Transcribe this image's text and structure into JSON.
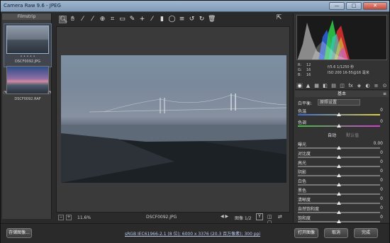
{
  "window": {
    "title": "Camera Raw 9.6 - JPEG",
    "buttons": [
      "—",
      "□",
      "✕"
    ]
  },
  "filmstrip": {
    "title": "Filmstrip",
    "items": [
      {
        "name": "DSCF0092.JPG",
        "stars": "• • • • •",
        "selected": true
      },
      {
        "name": "DSCF0092.RAF",
        "stars": "",
        "selected": false
      }
    ]
  },
  "toolbar": {
    "tools": [
      {
        "name": "zoom-tool-icon",
        "glyph": "🔍︎",
        "active": true
      },
      {
        "name": "hand-tool-icon",
        "glyph": "✋︎",
        "active": false
      },
      {
        "name": "white-balance-tool-icon",
        "glyph": "⁄",
        "active": false
      },
      {
        "name": "color-sampler-tool-icon",
        "glyph": "⁄",
        "active": false
      },
      {
        "name": "target-adjustment-tool-icon",
        "glyph": "⊕",
        "active": false
      },
      {
        "name": "crop-tool-icon",
        "glyph": "⌗",
        "active": false
      },
      {
        "name": "straighten-tool-icon",
        "glyph": "▭",
        "active": false
      },
      {
        "name": "spot-removal-tool-icon",
        "glyph": "✎",
        "active": false
      },
      {
        "name": "red-eye-tool-icon",
        "glyph": "+",
        "active": false
      },
      {
        "name": "adjustment-brush-icon",
        "glyph": "⁄",
        "active": false
      },
      {
        "name": "graduated-filter-icon",
        "glyph": "▮",
        "active": false
      },
      {
        "name": "radial-filter-icon",
        "glyph": "◯",
        "active": false
      },
      {
        "name": "preferences-icon",
        "glyph": "≡",
        "active": false
      },
      {
        "name": "rotate-ccw-icon",
        "glyph": "↺",
        "active": false
      },
      {
        "name": "rotate-cw-icon",
        "glyph": "↻",
        "active": false
      },
      {
        "name": "delete-icon",
        "glyph": "🗑︎",
        "active": false
      }
    ],
    "open_icon": "⇱"
  },
  "canvas_footer": {
    "zoom_minus": "−",
    "zoom_plus": "+",
    "zoom": "11.6%",
    "filename": "DSCF0092.JPG",
    "nav": "◀ ▶",
    "page": "图像 1/2",
    "y_label": "Y",
    "compare_icons": "◫ ⇄ ▢"
  },
  "histogram": {
    "readout": {
      "r": "R:",
      "r_val": "12",
      "g": "G:",
      "g_val": "16",
      "b": "B:",
      "b_val": "16",
      "exposure": "f/5.6  1/1250 秒",
      "iso": "ISO 200   16-55@16 毫米"
    }
  },
  "panel": {
    "tabs": [
      "◉",
      "▲",
      "▦",
      "◧",
      "▤",
      "◫",
      "fx",
      "◈",
      "◐",
      "≡",
      "⊙"
    ],
    "section": "基本",
    "section_menu": "≡",
    "wb_label": "白平衡:",
    "wb_value": "原照设置",
    "auto": "自动",
    "default": "默认值",
    "sliders": [
      {
        "label": "色温",
        "value": "0",
        "pos": 0.5
      },
      {
        "label": "色调",
        "value": "0",
        "pos": 0.5
      },
      {
        "label": "曝光",
        "value": "0.00",
        "pos": 0.5
      },
      {
        "label": "对比度",
        "value": "0",
        "pos": 0.5
      },
      {
        "label": "高光",
        "value": "0",
        "pos": 0.5
      },
      {
        "label": "阴影",
        "value": "0",
        "pos": 0.5
      },
      {
        "label": "白色",
        "value": "0",
        "pos": 0.5
      },
      {
        "label": "黑色",
        "value": "0",
        "pos": 0.5
      },
      {
        "label": "清晰度",
        "value": "0",
        "pos": 0.5
      },
      {
        "label": "自然饱和度",
        "value": "0",
        "pos": 0.5
      },
      {
        "label": "饱和度",
        "value": "0",
        "pos": 0.5
      }
    ]
  },
  "bottom": {
    "save": "存储图像...",
    "info": "sRGB IEC61966-2.1 (8 位); 6000 x 3376 (20.3 百万像素); 300 ppi",
    "open": "打开图像",
    "cancel": "取消",
    "done": "完成"
  }
}
